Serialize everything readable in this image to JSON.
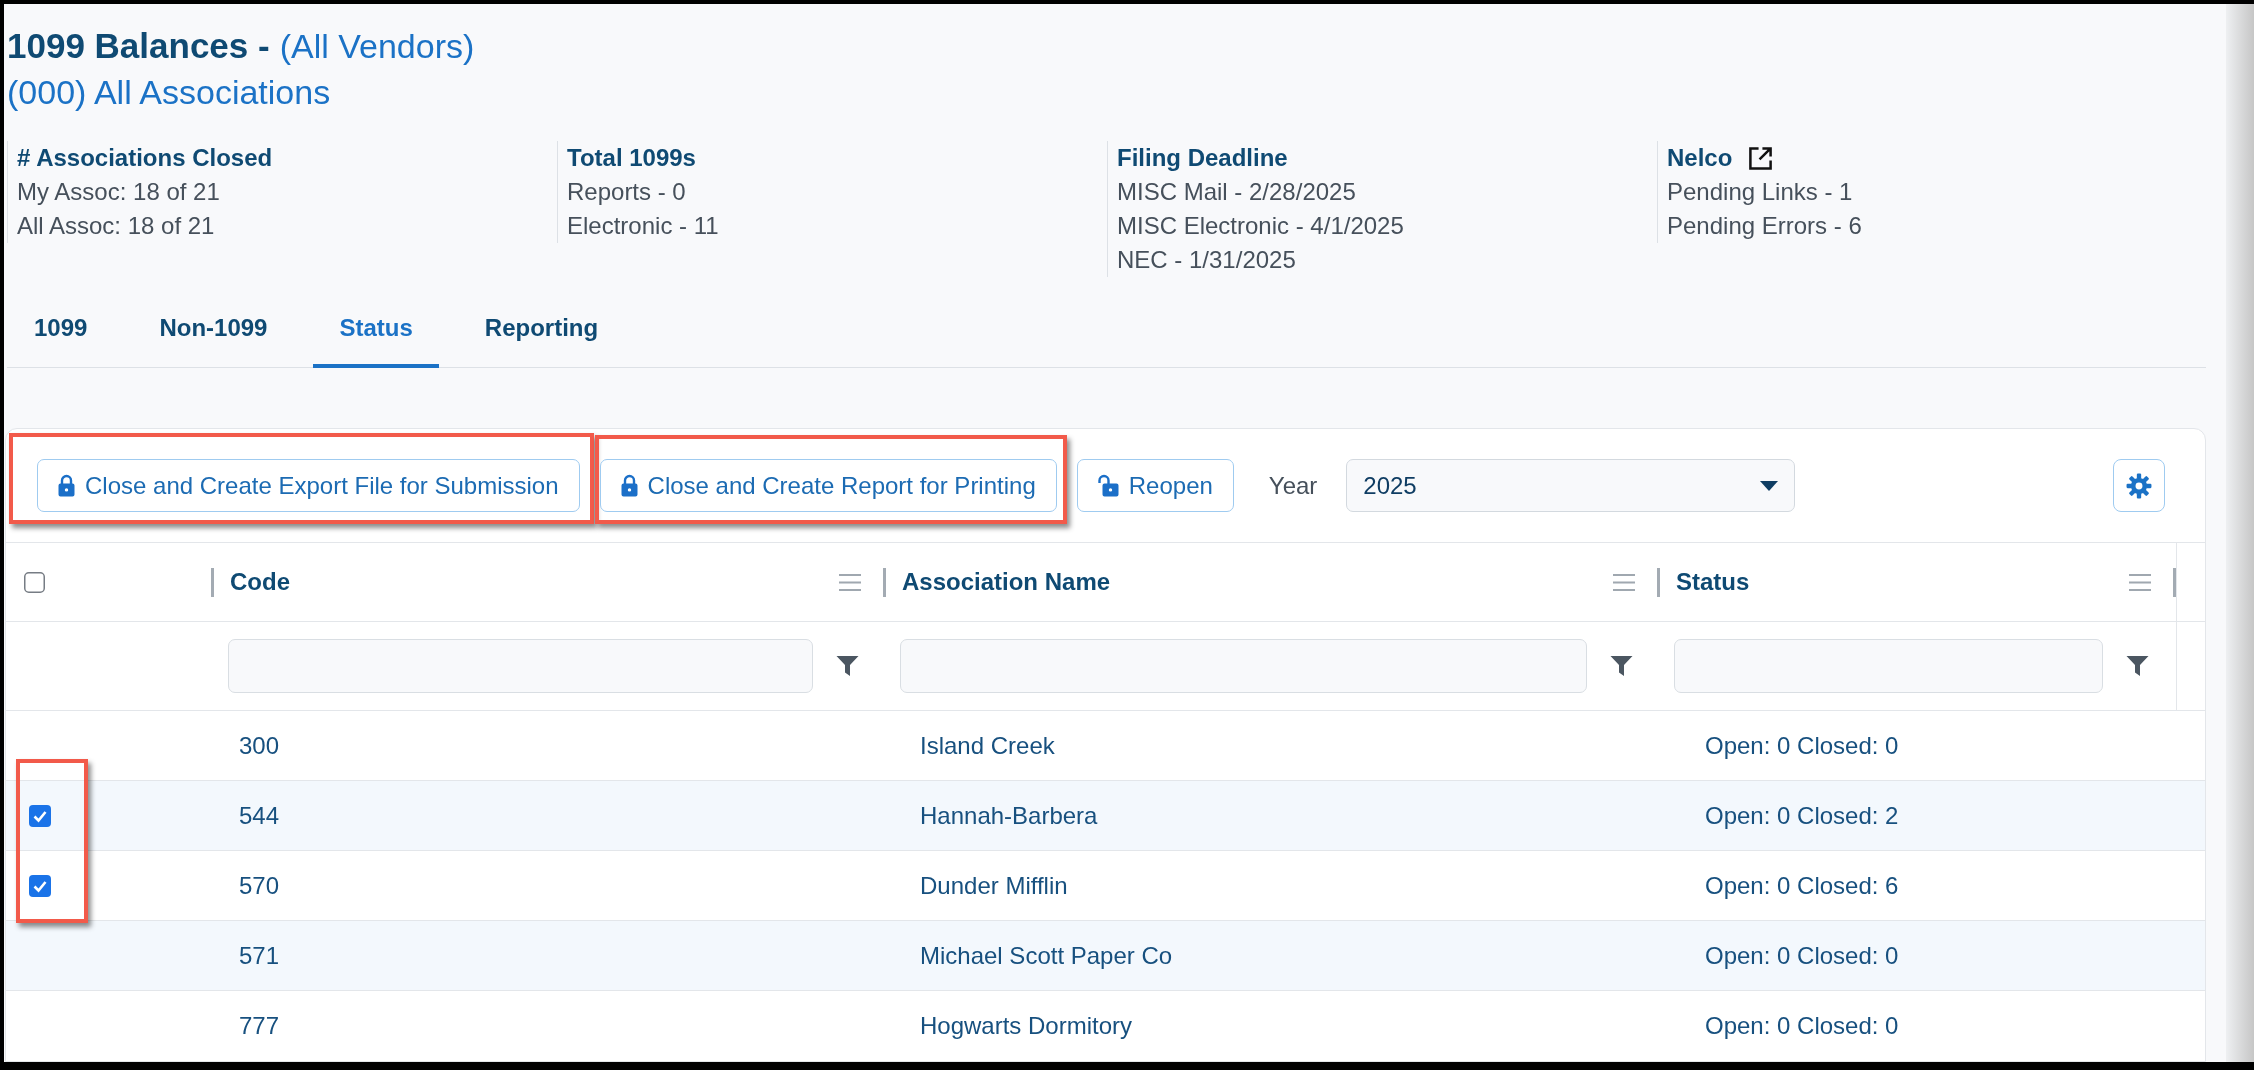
{
  "header": {
    "title": "1099 Balances -",
    "vendor_filter": "(All Vendors)",
    "association": "(000) All Associations"
  },
  "summary": [
    {
      "heading": "# Associations Closed",
      "external_link": false,
      "lines": [
        "My Assoc: 18 of 21",
        "All Assoc: 18 of 21"
      ]
    },
    {
      "heading": "Total 1099s",
      "external_link": false,
      "lines": [
        "Reports - 0",
        "Electronic - 11"
      ]
    },
    {
      "heading": "Filing Deadline",
      "external_link": false,
      "lines": [
        "MISC Mail - 2/28/2025",
        "MISC Electronic - 4/1/2025",
        "NEC - 1/31/2025"
      ]
    },
    {
      "heading": "Nelco",
      "external_link": true,
      "lines": [
        "Pending Links - 1",
        "Pending Errors - 6"
      ]
    }
  ],
  "tabs": [
    {
      "label": "1099",
      "selected": false
    },
    {
      "label": "Non-1099",
      "selected": false
    },
    {
      "label": "Status",
      "selected": true
    },
    {
      "label": "Reporting",
      "selected": false
    }
  ],
  "toolbar": {
    "buttons": [
      {
        "label": "Close and Create Export File for Submission",
        "kind": "lock",
        "highlighted": true
      },
      {
        "label": "Close and Create Report for Printing",
        "kind": "lock",
        "highlighted": true
      },
      {
        "label": "Reopen",
        "kind": "unlock",
        "highlighted": false
      }
    ],
    "year": {
      "label": "Year",
      "value": "2025"
    }
  },
  "table": {
    "select_all_checked": false,
    "columns": [
      "Code",
      "Association Name",
      "Status"
    ],
    "rows": [
      {
        "code": "300",
        "name": "Island Creek",
        "status": "Open: 0 Closed: 0",
        "checked": false,
        "highlighted": false
      },
      {
        "code": "544",
        "name": "Hannah-Barbera",
        "status": "Open: 0 Closed: 2",
        "checked": true,
        "highlighted": true
      },
      {
        "code": "570",
        "name": "Dunder Mifflin",
        "status": "Open: 0 Closed: 6",
        "checked": true,
        "highlighted": true
      },
      {
        "code": "571",
        "name": "Michael Scott Paper Co",
        "status": "Open: 0 Closed: 0",
        "checked": false,
        "highlighted": false
      },
      {
        "code": "777",
        "name": "Hogwarts Dormitory",
        "status": "Open: 0 Closed: 0",
        "checked": false,
        "highlighted": false
      }
    ]
  }
}
